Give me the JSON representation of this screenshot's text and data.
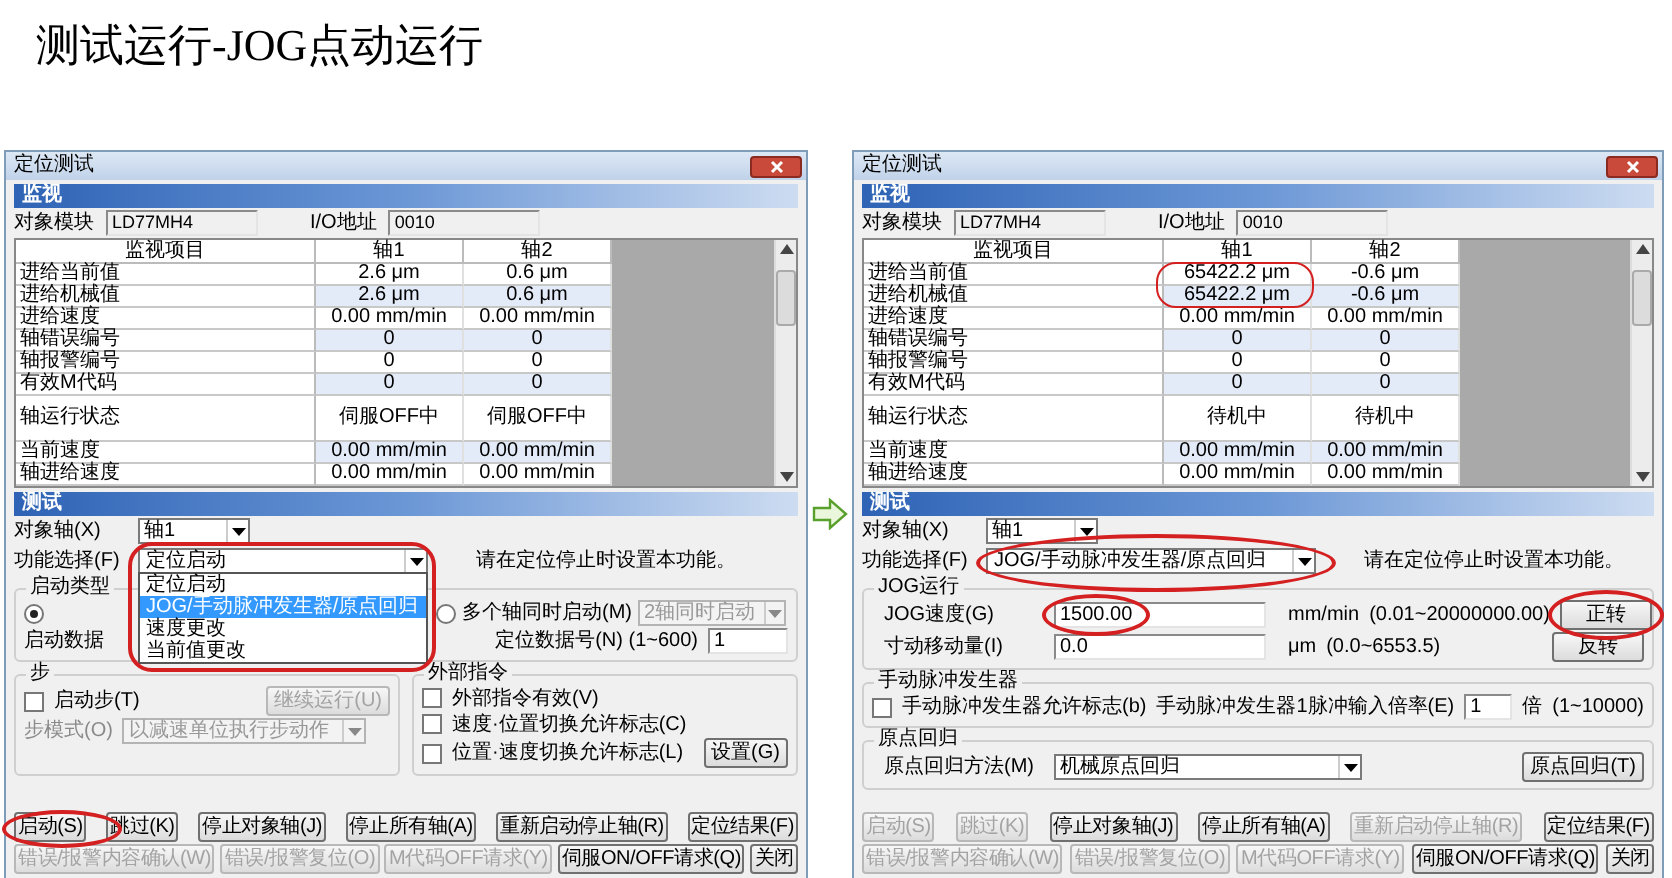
{
  "title": "测试运行-JOG点动运行",
  "windows": [
    {
      "kind": "positioning",
      "title": "定位测试",
      "monitor": {
        "header": "监视",
        "module_label": "对象模块",
        "module": "LD77MH4",
        "io_label": "I/O地址",
        "io": "0010",
        "columns": [
          "监视项目",
          "轴1",
          "轴2"
        ],
        "rows": [
          {
            "kind": "value",
            "label": "进给当前值",
            "values": [
              "2.6 μm",
              "0.6 μm"
            ]
          },
          {
            "kind": "value",
            "label": "进给机械值",
            "values": [
              "2.6 μm",
              "0.6 μm"
            ]
          },
          {
            "kind": "value",
            "label": "进给速度",
            "values": [
              "0.00 mm/min",
              "0.00 mm/min"
            ]
          },
          {
            "kind": "value",
            "label": "轴错误编号",
            "values": [
              "0",
              "0"
            ]
          },
          {
            "kind": "value",
            "label": "轴报警编号",
            "values": [
              "0",
              "0"
            ]
          },
          {
            "kind": "value",
            "label": "有效M代码",
            "values": [
              "0",
              "0"
            ]
          },
          {
            "kind": "status",
            "label": "轴运行状态",
            "values": [
              "伺服OFF中",
              "伺服OFF中"
            ]
          },
          {
            "kind": "value",
            "label": "当前速度",
            "values": [
              "0.00 mm/min",
              "0.00 mm/min"
            ]
          },
          {
            "kind": "value",
            "label": "轴进给速度",
            "values": [
              "0.00 mm/min",
              "0.00 mm/min"
            ]
          }
        ]
      },
      "test": {
        "header": "测试",
        "axis_label": "对象轴(X)",
        "axis": "轴1",
        "function_label": "功能选择(F)",
        "function": "定位启动",
        "hint": "请在定位停止时设置本功能。",
        "function_options": [
          {
            "label": "定位启动",
            "selected": false
          },
          {
            "label": "JOG/手动脉冲发生器/原点回归",
            "selected": true
          },
          {
            "label": "速度更改",
            "selected": false
          },
          {
            "label": "当前值更改",
            "selected": false
          }
        ],
        "start_type": {
          "title": "启动类型",
          "radios": [
            {
              "selected": true
            },
            {
              "label": "多个轴同时启动(M)",
              "selected": false
            }
          ],
          "sync_select": {
            "value": "2轴同时启动",
            "disabled": true
          },
          "data_title": "启动数据",
          "data_label": "定位数据号(N) (1~600)",
          "data_value": "1"
        },
        "step": {
          "title": "步",
          "checkbox": {
            "label": "启动步(T)",
            "checked": false
          },
          "continue_button": {
            "label": "继续运行(U)",
            "disabled": true
          },
          "mode_label": "步模式(O)",
          "mode": {
            "value": "以减速单位执行步动作",
            "disabled": true
          }
        },
        "external": {
          "title": "外部指令",
          "checkboxes": [
            {
              "label": "外部指令有效(V)",
              "checked": false
            },
            {
              "label": "速度·位置切换允许标志(C)",
              "checked": false
            },
            {
              "label": "位置·速度切换允许标志(L)",
              "checked": false
            }
          ],
          "button": "设置(G)"
        }
      },
      "buttons": [
        [
          {
            "label": "启动(S)",
            "disabled": false
          },
          {
            "label": "跳过(K)",
            "disabled": false
          },
          {
            "label": "停止对象轴(J)",
            "disabled": false
          },
          {
            "label": "停止所有轴(A)",
            "disabled": false
          },
          {
            "label": "重新启动停止轴(R)",
            "disabled": false
          },
          {
            "label": "定位结果(F)",
            "disabled": false
          }
        ],
        [
          {
            "label": "错误/报警内容确认(W)",
            "disabled": true
          },
          {
            "label": "错误/报警复位(O)",
            "disabled": true
          },
          {
            "label": "M代码OFF请求(Y)",
            "disabled": true
          },
          {
            "label": "伺服ON/OFF请求(Q)",
            "disabled": false
          },
          {
            "label": "关闭",
            "disabled": false
          }
        ]
      ]
    },
    {
      "kind": "jog",
      "title": "定位测试",
      "monitor": {
        "header": "监视",
        "module_label": "对象模块",
        "module": "LD77MH4",
        "io_label": "I/O地址",
        "io": "0010",
        "columns": [
          "监视项目",
          "轴1",
          "轴2"
        ],
        "rows": [
          {
            "kind": "value",
            "label": "进给当前值",
            "values": [
              "65422.2 μm",
              "-0.6 μm"
            ]
          },
          {
            "kind": "value",
            "label": "进给机械值",
            "values": [
              "65422.2 μm",
              "-0.6 μm"
            ]
          },
          {
            "kind": "value",
            "label": "进给速度",
            "values": [
              "0.00 mm/min",
              "0.00 mm/min"
            ]
          },
          {
            "kind": "value",
            "label": "轴错误编号",
            "values": [
              "0",
              "0"
            ]
          },
          {
            "kind": "value",
            "label": "轴报警编号",
            "values": [
              "0",
              "0"
            ]
          },
          {
            "kind": "value",
            "label": "有效M代码",
            "values": [
              "0",
              "0"
            ]
          },
          {
            "kind": "status",
            "label": "轴运行状态",
            "values": [
              "待机中",
              "待机中"
            ]
          },
          {
            "kind": "value",
            "label": "当前速度",
            "values": [
              "0.00 mm/min",
              "0.00 mm/min"
            ]
          },
          {
            "kind": "value",
            "label": "轴进给速度",
            "values": [
              "0.00 mm/min",
              "0.00 mm/min"
            ]
          }
        ]
      },
      "test": {
        "header": "测试",
        "axis_label": "对象轴(X)",
        "axis": "轴1",
        "function_label": "功能选择(F)",
        "function": "JOG/手动脉冲发生器/原点回归",
        "hint": "请在定位停止时设置本功能。",
        "jog": {
          "title": "JOG运行",
          "rows": [
            {
              "label": "JOG速度(G)",
              "value": "1500.00",
              "unit": "mm/min",
              "range": "(0.01~20000000.00)",
              "button": "正转"
            },
            {
              "label": "寸动移动量(I)",
              "value": "0.0",
              "unit": "μm",
              "range": "(0.0~6553.5)",
              "button": "反转"
            }
          ]
        },
        "pulse": {
          "title": "手动脉冲发生器",
          "checkbox": {
            "label": "手动脉冲发生器允许标志(b)",
            "checked": false
          },
          "rate_label": "手动脉冲发生器1脉冲输入倍率(E)",
          "rate": "1",
          "unit": "倍",
          "range": "(1~10000)"
        },
        "home": {
          "title": "原点回归",
          "method_label": "原点回归方法(M)",
          "method": "机械原点回归",
          "button": "原点回归(T)"
        }
      },
      "buttons": [
        [
          {
            "label": "启动(S)",
            "disabled": true
          },
          {
            "label": "跳过(K)",
            "disabled": true
          },
          {
            "label": "停止对象轴(J)",
            "disabled": false
          },
          {
            "label": "停止所有轴(A)",
            "disabled": false
          },
          {
            "label": "重新启动停止轴(R)",
            "disabled": true
          },
          {
            "label": "定位结果(F)",
            "disabled": false
          }
        ],
        [
          {
            "label": "错误/报警内容确认(W)",
            "disabled": true
          },
          {
            "label": "错误/报警复位(O)",
            "disabled": true
          },
          {
            "label": "M代码OFF请求(Y)",
            "disabled": true
          },
          {
            "label": "伺服ON/OFF请求(Q)",
            "disabled": false
          },
          {
            "label": "关闭",
            "disabled": false
          }
        ]
      ]
    }
  ]
}
